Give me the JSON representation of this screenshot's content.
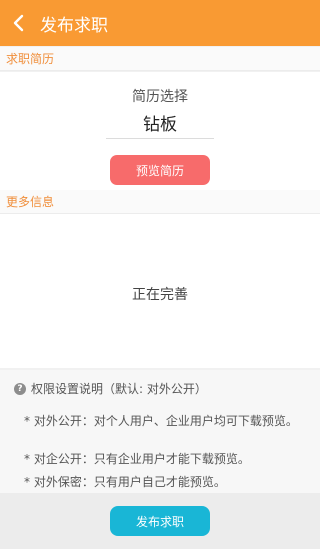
{
  "header": {
    "title": "发布求职",
    "back_icon": "chevron-left-icon"
  },
  "resume_section": {
    "label": "求职简历",
    "select_label": "简历选择",
    "selected_resume": "钻板",
    "preview_button": "预览简历"
  },
  "more_section": {
    "label": "更多信息",
    "status": "正在完善"
  },
  "notes": {
    "title": "权限设置说明（默认: 对外公开）",
    "items": [
      "* 对外公开：对个人用户、企业用户均可下载预览。",
      "* 对企公开：只有企业用户才能下载预览。",
      "* 对外保密：只有用户自己才能预览。"
    ]
  },
  "footer": {
    "publish_button": "发布求职"
  },
  "colors": {
    "header": "#f99a33",
    "preview_button": "#f76b6b",
    "publish_button": "#19b6d6",
    "section_label": "#f08f3c"
  }
}
